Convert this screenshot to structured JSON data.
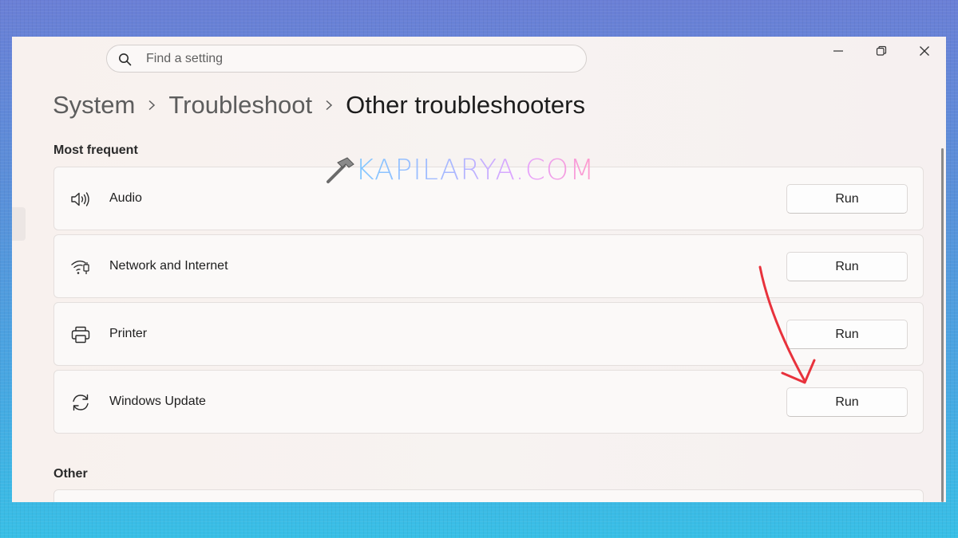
{
  "search": {
    "placeholder": "Find a setting"
  },
  "breadcrumb": {
    "items": [
      "System",
      "Troubleshoot",
      "Other troubleshooters"
    ]
  },
  "sections": {
    "most_frequent": "Most frequent",
    "other": "Other"
  },
  "troubleshooters": [
    {
      "label": "Audio",
      "icon": "speaker-icon",
      "button": "Run"
    },
    {
      "label": "Network and Internet",
      "icon": "network-icon",
      "button": "Run"
    },
    {
      "label": "Printer",
      "icon": "printer-icon",
      "button": "Run"
    },
    {
      "label": "Windows Update",
      "icon": "refresh-icon",
      "button": "Run"
    }
  ],
  "watermark": {
    "text": "KAPILARYA.COM",
    "icon": "hammer-icon"
  },
  "colors": {
    "annotation_arrow": "#e8323c"
  }
}
